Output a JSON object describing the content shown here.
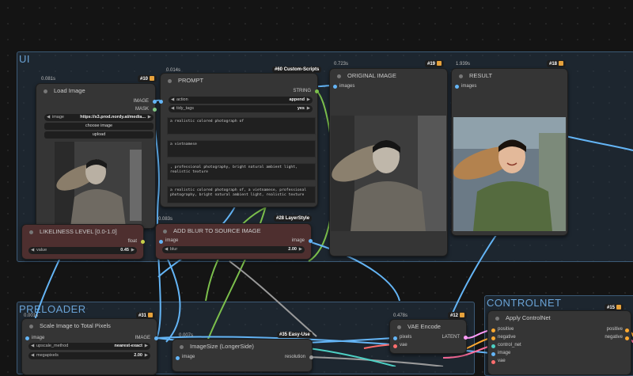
{
  "groups": {
    "ui": "UI",
    "preloader": "PRELOADER",
    "controlnet": "CONTROLNET"
  },
  "nodes": {
    "load_image": {
      "title": "Load Image",
      "timing": "0.081s",
      "badge": "#10",
      "outputs": [
        "IMAGE",
        "MASK"
      ],
      "image_widget": {
        "name": "image",
        "value": "https://s3.prod.nordy.ai/media..."
      },
      "choose_label": "choose image",
      "upload_label": "upload"
    },
    "prompt": {
      "title": "PROMPT",
      "timing": "0.014s",
      "badge": "#60 Custom-Scripts",
      "output": "STRING",
      "widgets": [
        {
          "name": "action",
          "value": "append"
        },
        {
          "name": "tidy_tags",
          "value": "yes"
        }
      ],
      "texts": [
        "a realistic colored photograph of",
        "a vietnamese",
        ", professional photography, bright natural ambient light, realistic texture",
        "a realistic colored photograph of, a vietnamese, professional photography, bright natural ambient light, realistic texture"
      ]
    },
    "original_image": {
      "title": "ORIGINAL IMAGE",
      "timing": "0.723s",
      "badge": "#19",
      "input": "images"
    },
    "result": {
      "title": "RESULT",
      "timing": "1.939s",
      "badge": "#18",
      "input": "images"
    },
    "likeliness": {
      "title": "LIKELINESS LEVEL [0.0-1.0]",
      "output": "float",
      "widget": {
        "name": "value",
        "value": "0.45"
      }
    },
    "blur": {
      "title": "ADD BLUR TO SOURCE IMAGE",
      "timing": "0.083s",
      "badge": "#28 LayerStyle",
      "input": "image",
      "output": "image",
      "widget": {
        "name": "blur",
        "value": "2.00"
      }
    },
    "scale": {
      "title": "Scale Image to Total Pixels",
      "timing": "0.001s",
      "badge": "#31",
      "input": "image",
      "output": "IMAGE",
      "widgets": [
        {
          "name": "upscale_method",
          "value": "nearest-exact"
        },
        {
          "name": "megapixels",
          "value": "2.00"
        }
      ]
    },
    "imagesize": {
      "title": "ImageSize (LongerSide)",
      "timing": "0.007s",
      "badge": "#35 Easy-Use",
      "input": "image",
      "output": "resolution"
    },
    "vae": {
      "title": "VAE Encode",
      "timing": "0.478s",
      "badge": "#12",
      "inputs": [
        "pixels",
        "vae"
      ],
      "output": "LATENT"
    },
    "controlnet": {
      "title": "Apply ControlNet",
      "badge": "#15",
      "inputs": [
        "positive",
        "negative",
        "control_net",
        "image",
        "vae"
      ],
      "outputs": [
        "positive",
        "negative"
      ]
    }
  },
  "colors": {
    "image_port": "#64b5f6",
    "mask_port": "#81c784",
    "string_port": "#7cc04c",
    "float_port": "#c9d04a",
    "latent_port": "#ff9cf9",
    "vae_port": "#ff6e6e",
    "cond_port": "#ffa931"
  },
  "images": {
    "bw_description": "black-and-white portrait of a young woman carrying a woven basket on her shoulder",
    "color_description": "colorized portrait of a smiling young woman in green shirt carrying a woven basket"
  }
}
